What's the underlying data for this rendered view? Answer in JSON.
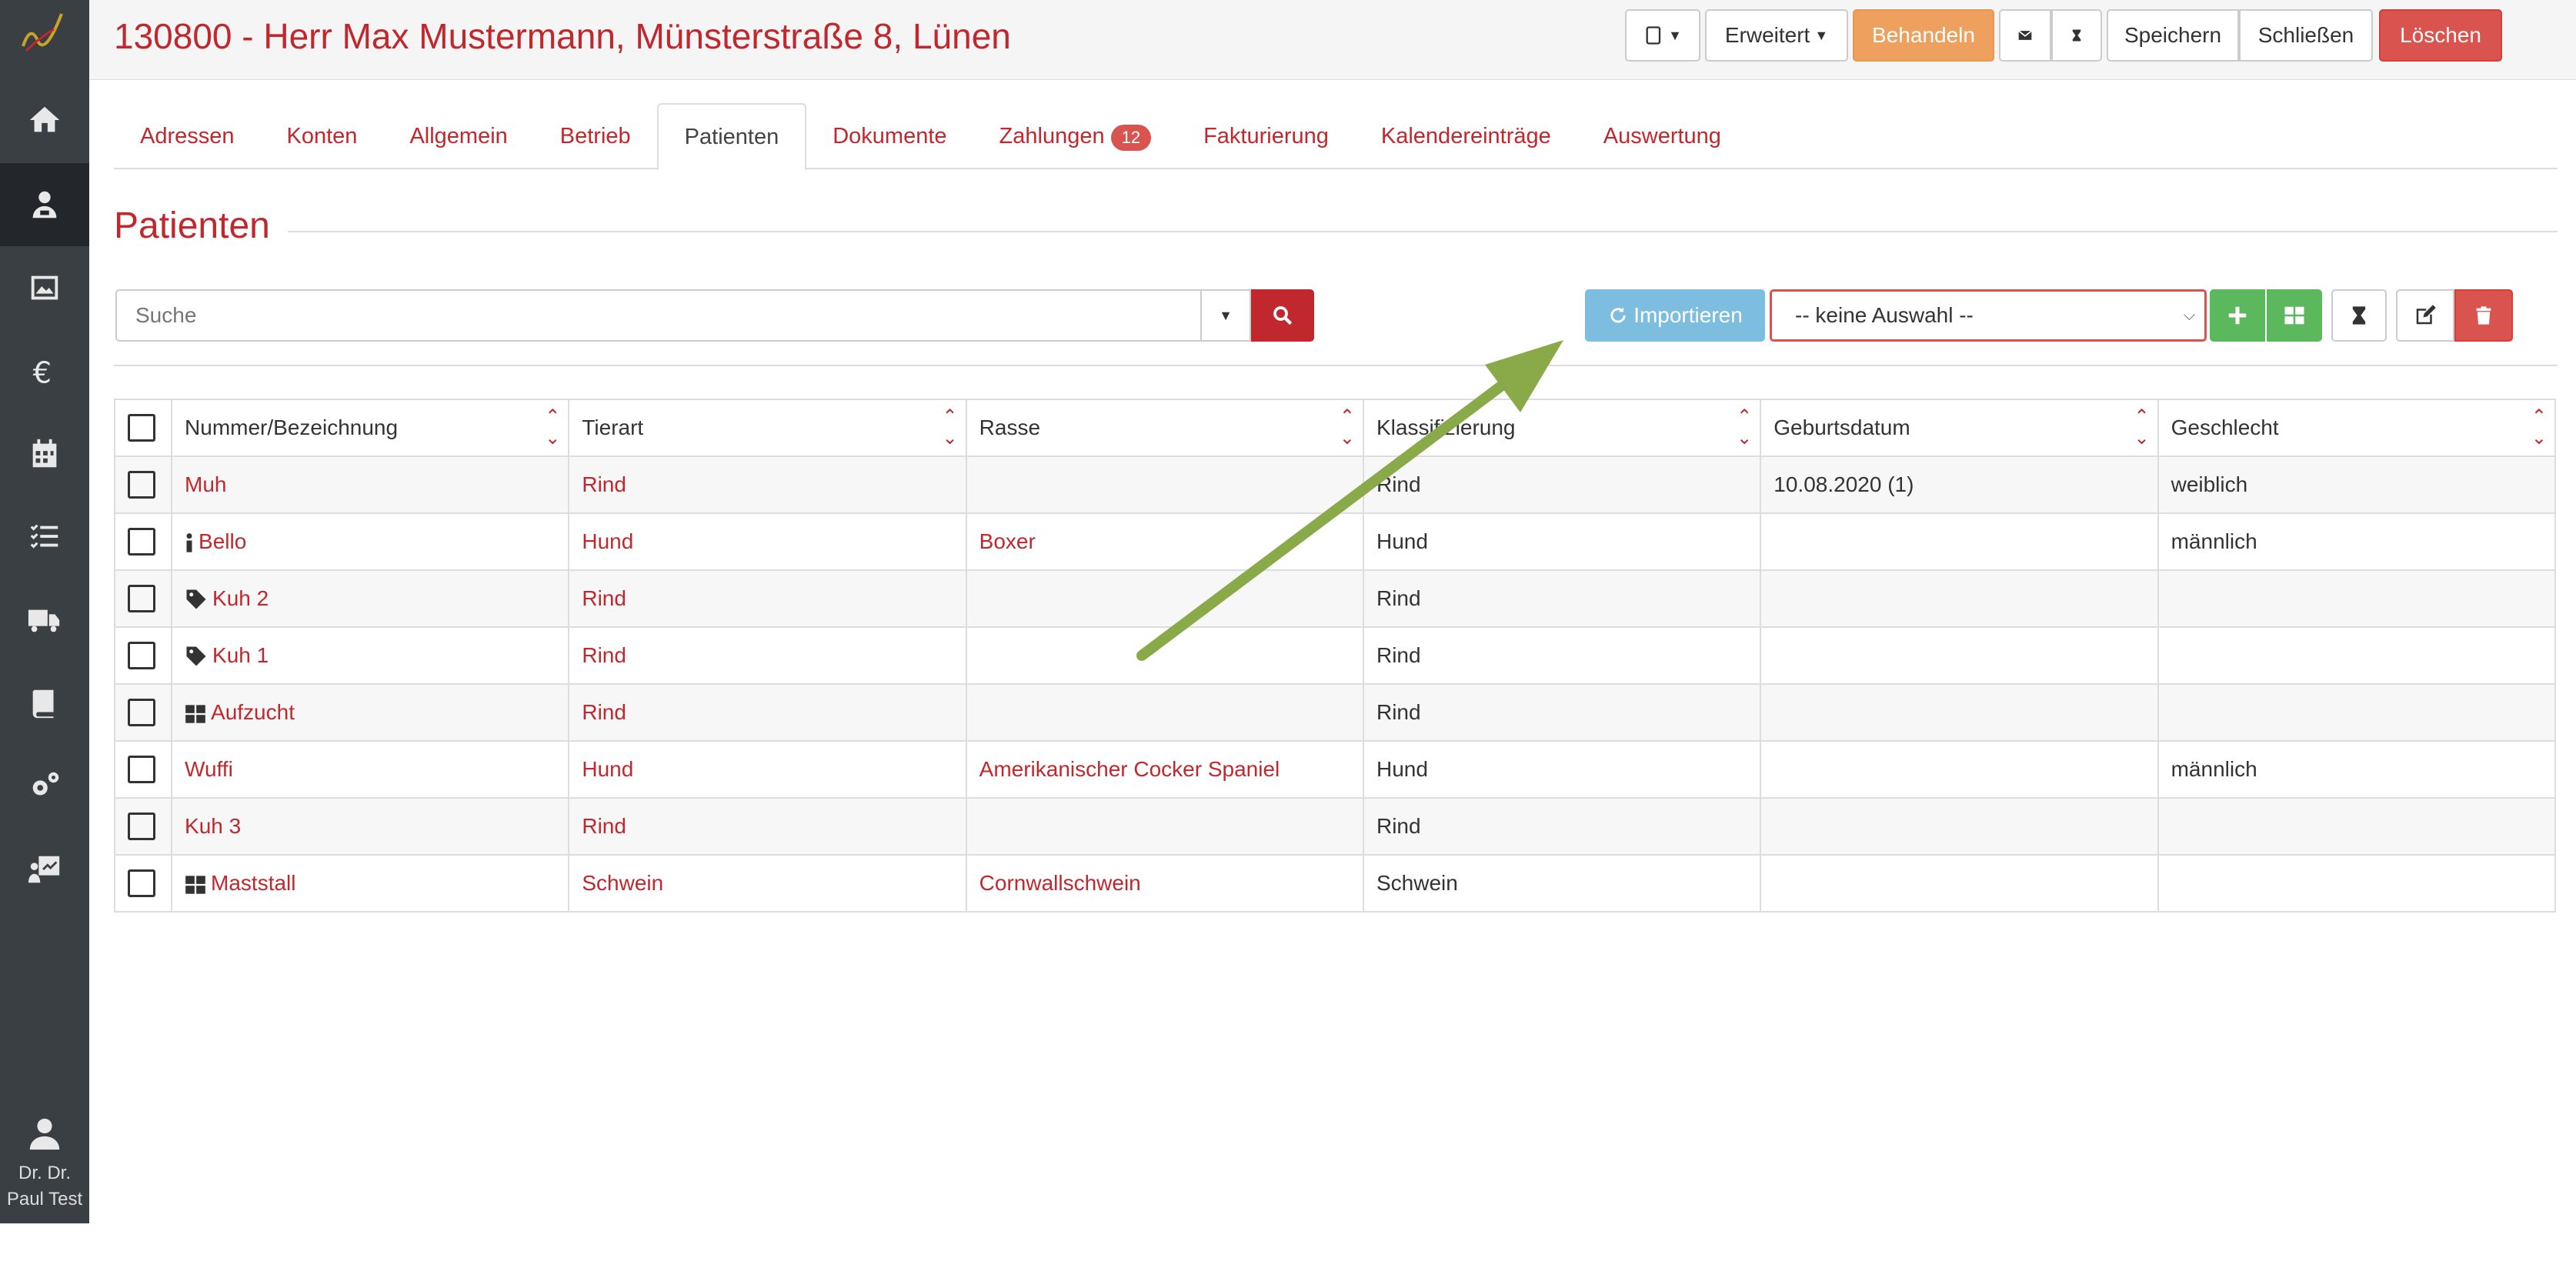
{
  "header": {
    "title": "130800 - Herr Max Mustermann, Münsterstraße 8, Lünen",
    "buttons": {
      "advanced": "Erweitert",
      "treat": "Behandeln",
      "save": "Speichern",
      "close": "Schließen",
      "delete": "Löschen"
    }
  },
  "tabs": [
    {
      "label": "Adressen"
    },
    {
      "label": "Konten"
    },
    {
      "label": "Allgemein"
    },
    {
      "label": "Betrieb"
    },
    {
      "label": "Patienten",
      "active": true
    },
    {
      "label": "Dokumente"
    },
    {
      "label": "Zahlungen",
      "badge": "12"
    },
    {
      "label": "Fakturierung"
    },
    {
      "label": "Kalendereinträge"
    },
    {
      "label": "Auswertung"
    }
  ],
  "section": {
    "title": "Patienten"
  },
  "toolbar": {
    "search_placeholder": "Suche",
    "import_label": "Importieren",
    "select_value": "-- keine Auswahl --"
  },
  "table": {
    "columns": [
      "Nummer/Bezeichnung",
      "Tierart",
      "Rasse",
      "Klassifizierung",
      "Geburtsdatum",
      "Geschlecht"
    ],
    "rows": [
      {
        "icon": "",
        "name": "Muh",
        "species": "Rind",
        "breed": "",
        "class": "Rind",
        "birth": "10.08.2020 (1)",
        "sex": "weiblich"
      },
      {
        "icon": "info-icon",
        "name": "Bello",
        "species": "Hund",
        "breed": "Boxer",
        "class": "Hund",
        "birth": "",
        "sex": "männlich"
      },
      {
        "icon": "tag-icon",
        "name": "Kuh 2",
        "species": "Rind",
        "breed": "",
        "class": "Rind",
        "birth": "",
        "sex": ""
      },
      {
        "icon": "tag-icon",
        "name": "Kuh 1",
        "species": "Rind",
        "breed": "",
        "class": "Rind",
        "birth": "",
        "sex": ""
      },
      {
        "icon": "grid-icon",
        "name": "Aufzucht",
        "species": "Rind",
        "breed": "",
        "class": "Rind",
        "birth": "",
        "sex": ""
      },
      {
        "icon": "",
        "name": "Wuffi",
        "species": "Hund",
        "breed": "Amerikanischer Cocker Spaniel",
        "class": "Hund",
        "birth": "",
        "sex": "männlich"
      },
      {
        "icon": "",
        "name": "Kuh 3",
        "species": "Rind",
        "breed": "",
        "class": "Rind",
        "birth": "",
        "sex": ""
      },
      {
        "icon": "grid-icon",
        "name": "Maststall",
        "species": "Schwein",
        "breed": "Cornwallschwein",
        "class": "Schwein",
        "birth": "",
        "sex": ""
      }
    ]
  },
  "user": {
    "name": "Dr. Dr.\nPaul Test"
  },
  "colors": {
    "brand_red": "#c0282d",
    "sidebar": "#3a3f44",
    "orange": "#eea05f",
    "green": "#5cb85c",
    "info_blue": "#7cbde0",
    "arrow_green": "#8aaa4a"
  }
}
